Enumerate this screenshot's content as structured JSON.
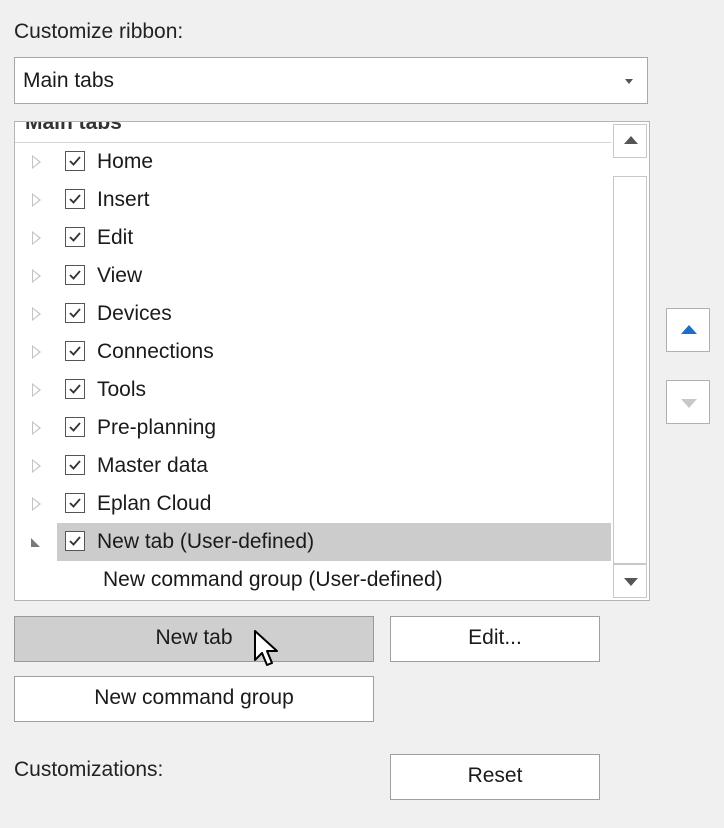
{
  "customize_ribbon_label": "Customize ribbon:",
  "dropdown": {
    "selected": "Main tabs"
  },
  "tree": {
    "header_cut": "Main tabs",
    "items": [
      {
        "label": "Home",
        "checked": true
      },
      {
        "label": "Insert",
        "checked": true
      },
      {
        "label": "Edit",
        "checked": true
      },
      {
        "label": "View",
        "checked": true
      },
      {
        "label": "Devices",
        "checked": true
      },
      {
        "label": "Connections",
        "checked": true
      },
      {
        "label": "Tools",
        "checked": true
      },
      {
        "label": "Pre-planning",
        "checked": true
      },
      {
        "label": "Master data",
        "checked": true
      },
      {
        "label": "Eplan Cloud",
        "checked": true
      },
      {
        "label": "New tab (User-defined)",
        "checked": true,
        "expanded": true,
        "selected": true
      }
    ],
    "child": "New command group (User-defined)"
  },
  "buttons": {
    "new_tab": "New tab",
    "edit": "Edit...",
    "new_command_group": "New command group",
    "reset": "Reset"
  },
  "customizations_label": "Customizations:",
  "colors": {
    "move_up_arrow": "#1a6fc9",
    "move_down_arrow": "#c8c8c8",
    "selected_row": "#cccccc"
  }
}
